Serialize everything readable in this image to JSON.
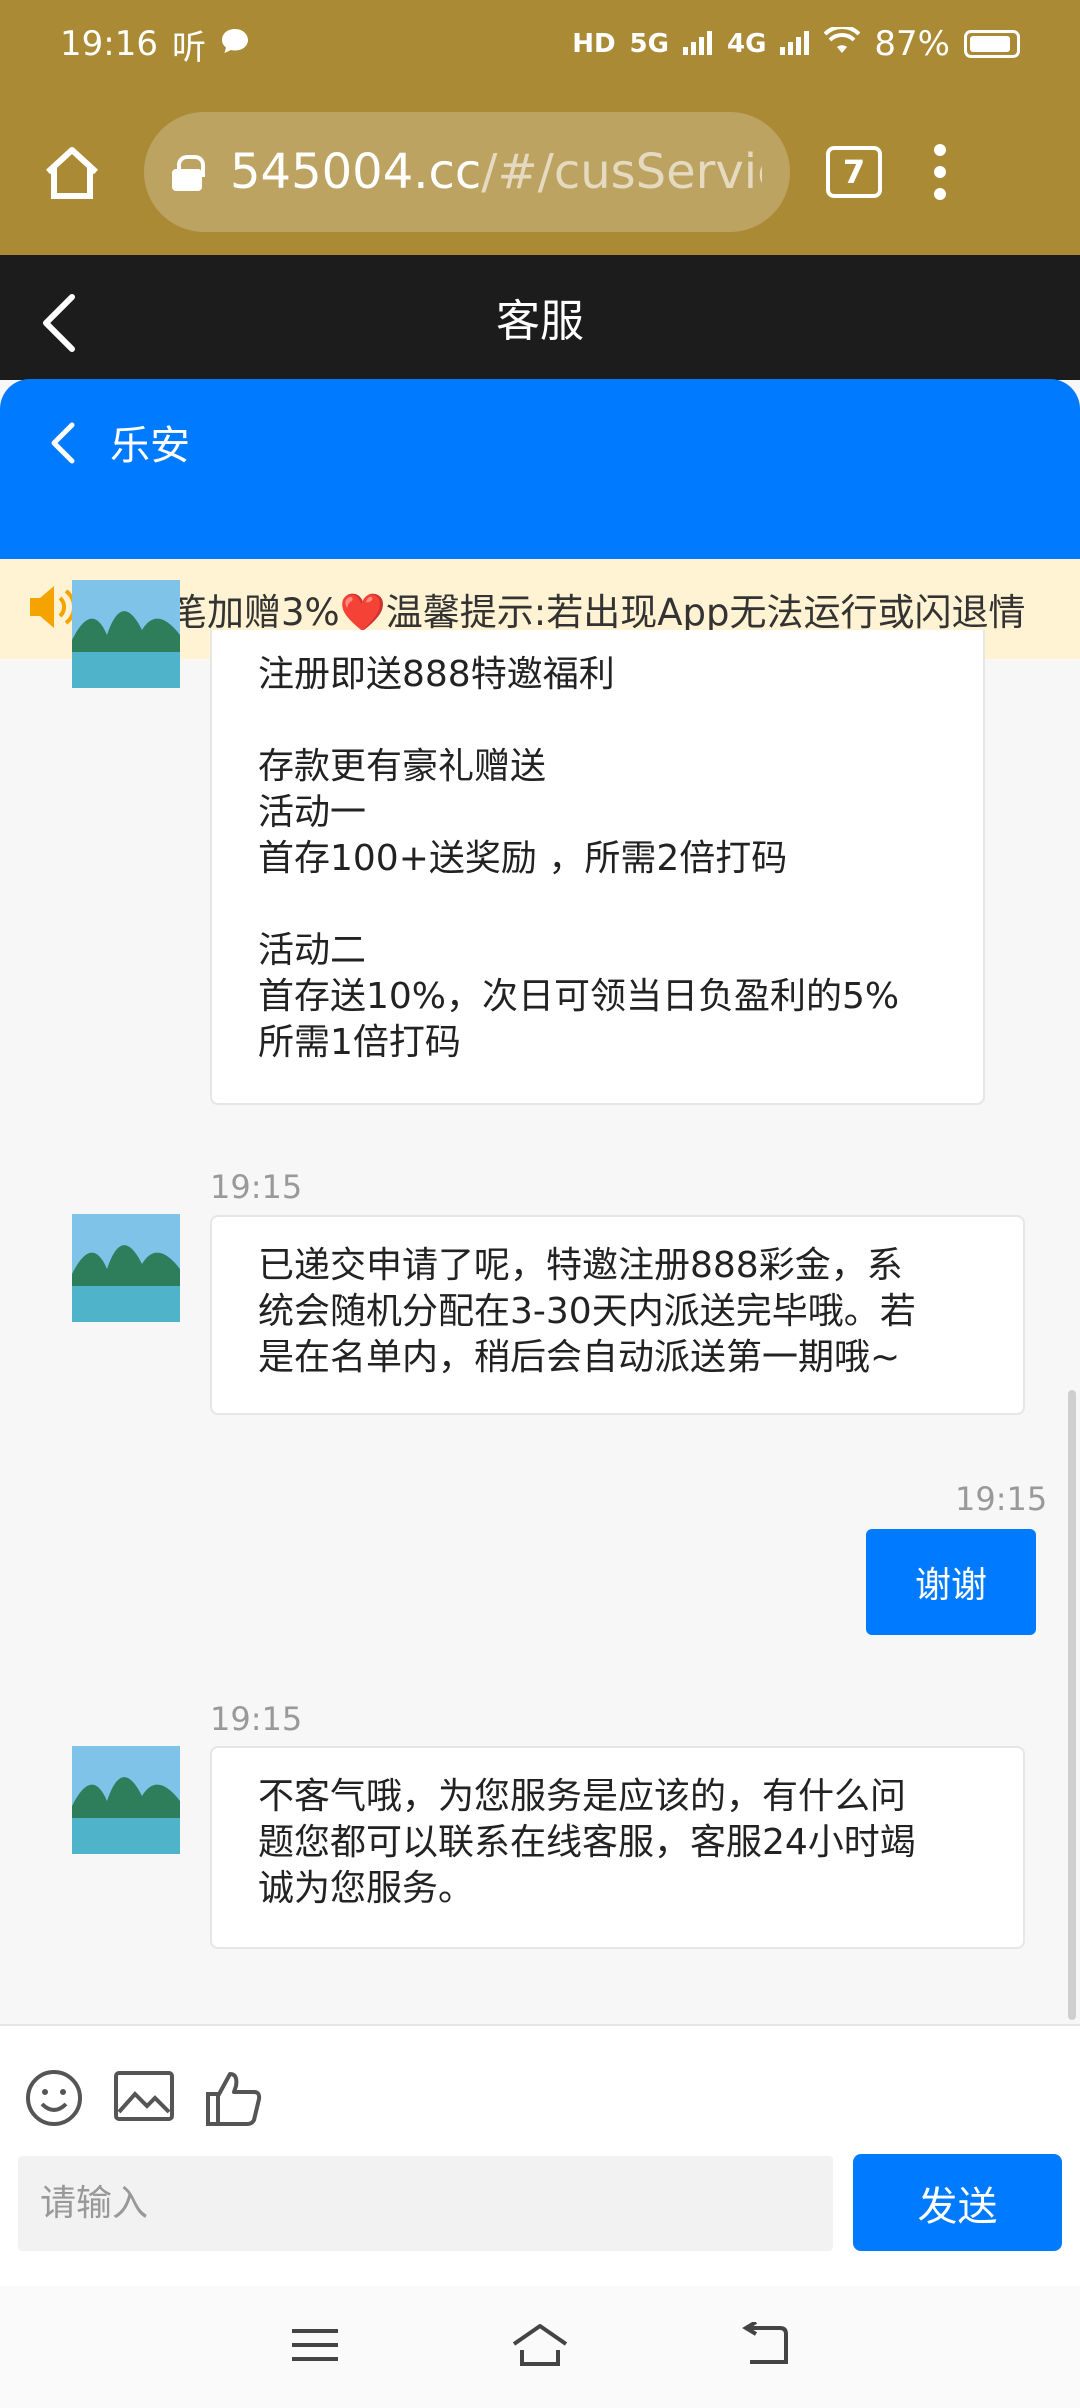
{
  "status_bar": {
    "time": "19:16",
    "carrier_glyph": "听",
    "network_labels": [
      "HD",
      "5G",
      "4G"
    ],
    "battery": "87%"
  },
  "browser": {
    "url": "545004.cc",
    "url_path": "/#/cusServic",
    "tab_count": "7"
  },
  "header": {
    "title": "客服"
  },
  "chat": {
    "agent_name": "乐安"
  },
  "notice": {
    "text": "，笔笔加赠3%❤️温馨提示:若出现App无法运行或闪退情"
  },
  "messages": [
    {
      "from": "agent",
      "lines": [
        "注册即送888特邀福利",
        "",
        "存款更有豪礼赠送",
        "活动一",
        "首存100+送奖励 ，所需2倍打码",
        "",
        "活动二",
        "首存送10%，次日可领当日负盈利的5%",
        "所需1倍打码"
      ]
    },
    {
      "from": "agent",
      "time": "19:15",
      "lines": [
        "已递交申请了呢，特邀注册888彩金，系",
        "统会随机分配在3-30天内派送完毕哦。若",
        "是在名单内，稍后会自动派送第一期哦~"
      ]
    },
    {
      "from": "me",
      "time": "19:15",
      "text": "谢谢"
    },
    {
      "from": "agent",
      "time": "19:15",
      "lines": [
        "不客气哦，为您服务是应该的，有什么问",
        "题您都可以联系在线客服，客服24小时竭",
        "诚为您服务。"
      ]
    }
  ],
  "input": {
    "placeholder": "请输入",
    "send_label": "发送"
  },
  "colors": {
    "browser_bar": "#ab8a35",
    "accent": "#007aff",
    "header": "#1c1c1c",
    "notice_bg": "#fff3d3"
  }
}
